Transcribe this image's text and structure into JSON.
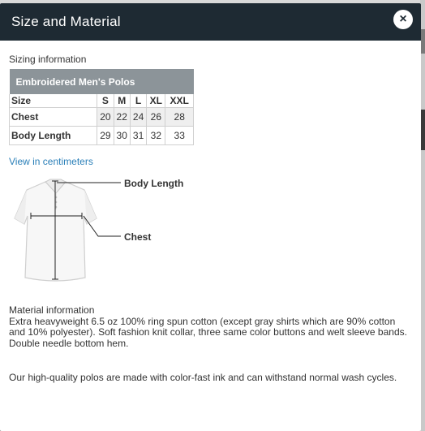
{
  "modal": {
    "title": "Size and Material",
    "close_glyph": "×"
  },
  "sizing": {
    "label": "Sizing information",
    "table_title": "Embroidered Men's Polos",
    "header": [
      "Size",
      "S",
      "M",
      "L",
      "XL",
      "XXL"
    ],
    "rows": [
      {
        "label": "Chest",
        "values": [
          "20",
          "22",
          "24",
          "26",
          "28"
        ]
      },
      {
        "label": "Body Length",
        "values": [
          "29",
          "30",
          "31",
          "32",
          "33"
        ]
      }
    ],
    "link": "View in centimeters"
  },
  "diagram": {
    "body_length_label": "Body Length",
    "chest_label": "Chest"
  },
  "material": {
    "title": "Material information",
    "text": "Extra heavyweight 6.5 oz 100% ring spun cotton (except gray shirts which are 90% cotton and 10% polyester). Soft fashion knit collar, three same color buttons and welt sleeve bands. Double needle bottom hem.",
    "care": "Our high-quality polos are made with color-fast ink and can withstand normal wash cycles."
  },
  "colors": {
    "header_bg": "#1e2a33",
    "table_header_bg": "#8c9499",
    "link": "#2a7fb8"
  }
}
